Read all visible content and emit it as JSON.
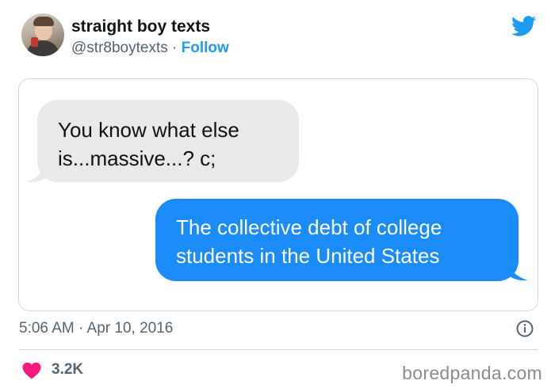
{
  "author": {
    "name": "straight boy texts",
    "handle": "@str8boytexts",
    "separator": "·",
    "follow_label": "Follow"
  },
  "icons": {
    "platform": "twitter-bird-icon",
    "info": "info-icon",
    "like": "heart-icon"
  },
  "colors": {
    "accent": "#1d9bf0",
    "bubble_incoming": "#e9e9eb",
    "bubble_outgoing": "#1a8bf7",
    "heart": "#f91880"
  },
  "messages": [
    {
      "direction": "incoming",
      "text": "You know what else is...massive...? c;"
    },
    {
      "direction": "outgoing",
      "text": "The collective debt of college students in the United States"
    }
  ],
  "timestamp": "5:06 AM · Apr 10, 2016",
  "likes": "3.2K",
  "watermark": "boredpanda.com"
}
